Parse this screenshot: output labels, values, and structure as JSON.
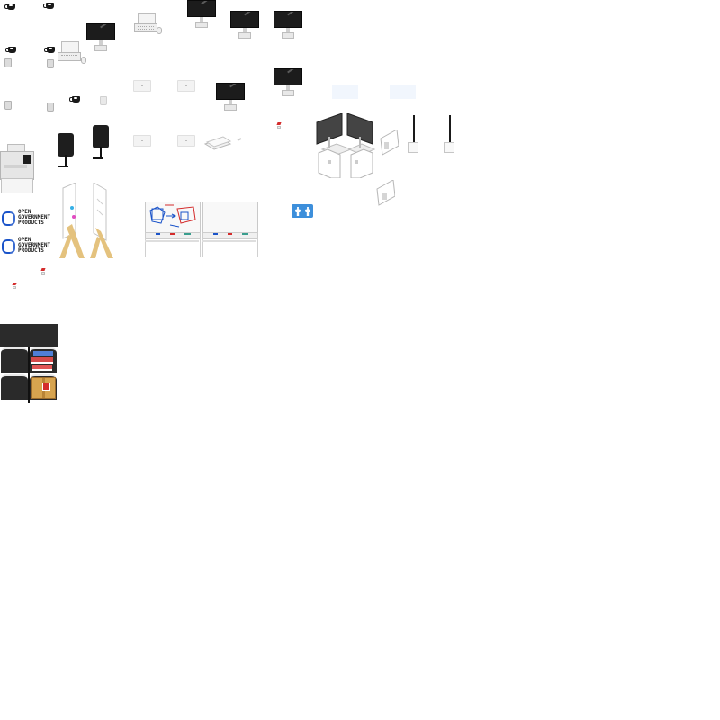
{
  "sheet": {
    "background": "#ffffff",
    "sprites": [
      {
        "name": "coffee-mug",
        "icon": "mug-icon"
      },
      {
        "name": "paper-cup",
        "icon": "cup-icon"
      },
      {
        "name": "laptop-with-mouse",
        "icon": "laptop-icon"
      },
      {
        "name": "desktop-monitor",
        "icon": "monitor-icon"
      },
      {
        "name": "tablet",
        "icon": "tablet-icon"
      },
      {
        "name": "office-chair",
        "icon": "chair-icon"
      },
      {
        "name": "printer-copier",
        "icon": "printer-icon"
      },
      {
        "name": "whiteboard-easel",
        "icon": "whiteboard-icon"
      },
      {
        "name": "whiteboard-with-diagram",
        "icon": "whiteboard-icon"
      },
      {
        "name": "restroom-sign",
        "icon": "restroom-icon"
      },
      {
        "name": "plant",
        "icon": "plant-icon"
      },
      {
        "name": "storage-shelf",
        "icon": "shelf-icon"
      },
      {
        "name": "dual-monitor-desk",
        "icon": "workstation-icon"
      }
    ]
  },
  "logos": [
    {
      "text": "OPEN\nGOVERNMENT\nPRODUCTS",
      "color": "#1a53c9"
    },
    {
      "text": "OPEN\nGOVERNMENT\nPRODUCTS",
      "color": "#1a53c9"
    }
  ],
  "colors": {
    "monitor": "#1c1c1c",
    "wood": "#e4c27e",
    "sign_blue": "#3d8fdb",
    "tile": "#f1f6fd",
    "marker_red": "#d42c2c",
    "marker_blue": "#1a53c9"
  }
}
